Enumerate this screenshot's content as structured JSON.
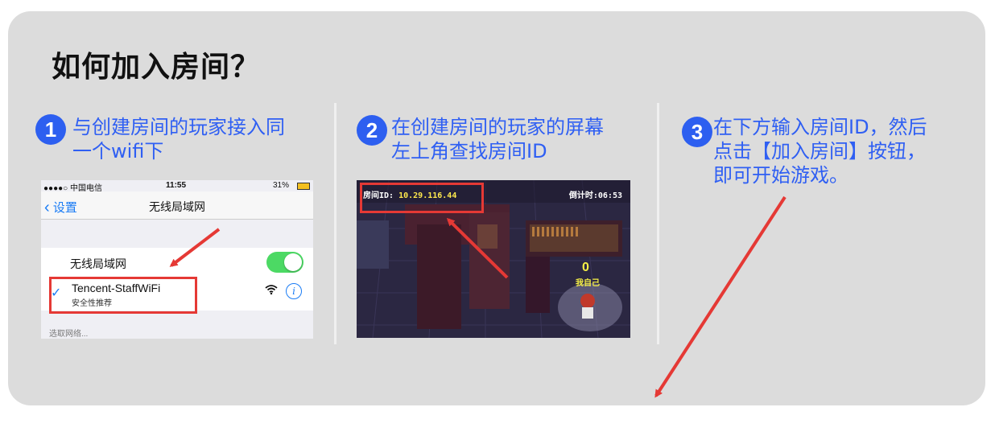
{
  "title": "如何加入房间？",
  "steps": [
    {
      "num": "1",
      "text_line1": "与创建房间的玩家接入同",
      "text_line2": "一个wifi下"
    },
    {
      "num": "2",
      "text_line1": "在创建房间的玩家的屏幕",
      "text_line2": "左上角查找房间ID"
    },
    {
      "num": "3",
      "text_line1": "在下方输入房间ID，然后",
      "text_line2": "点击【加入房间】按钮，",
      "text_line3": "即可开始游戏。"
    }
  ],
  "phone": {
    "status": {
      "carrier": "●●●●○ 中国电信",
      "time": "11:55",
      "battery": "31%"
    },
    "nav": {
      "back_label": "设置",
      "title": "无线局域网"
    },
    "wlan_label": "无线局域网",
    "wlan_enabled": true,
    "network": {
      "name": "Tencent-StaffWiFi",
      "subtitle": "安全性推荐",
      "info": "i"
    },
    "section_label": "选取网络..."
  },
  "game": {
    "room_label": "房间ID:",
    "room_id": "10.29.116.44",
    "timer_label": "倒计时:",
    "timer_value": "06:53",
    "score": "0",
    "player_label": "我自己"
  },
  "colors": {
    "accent": "#2f5ff3",
    "highlight": "#e53935",
    "card": "#dcdcdc"
  }
}
